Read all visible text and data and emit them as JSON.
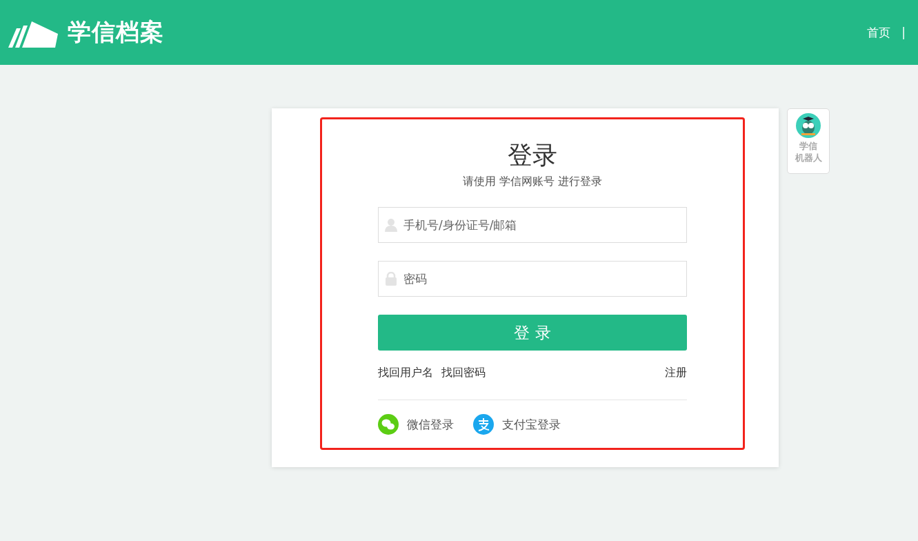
{
  "header": {
    "brand": "学信档案",
    "nav": [
      {
        "label": "首页"
      }
    ],
    "nav_separator": "|"
  },
  "login": {
    "title": "登录",
    "subtitle": "请使用 学信网账号 进行登录",
    "fields": [
      {
        "kind": "user",
        "placeholder": "手机号/身份证号/邮箱"
      },
      {
        "kind": "password",
        "placeholder": "密码"
      }
    ],
    "submit": "登 录",
    "links": [
      {
        "label": "找回用户名"
      },
      {
        "label": "找回密码"
      }
    ],
    "register": "注册",
    "social": [
      {
        "kind": "wechat",
        "label": "微信登录",
        "color": "#5ccd14"
      },
      {
        "kind": "alipay",
        "label": "支付宝登录",
        "color": "#1aa7ee"
      }
    ]
  },
  "robot": {
    "label_lines": [
      "学信",
      "机器人"
    ]
  }
}
